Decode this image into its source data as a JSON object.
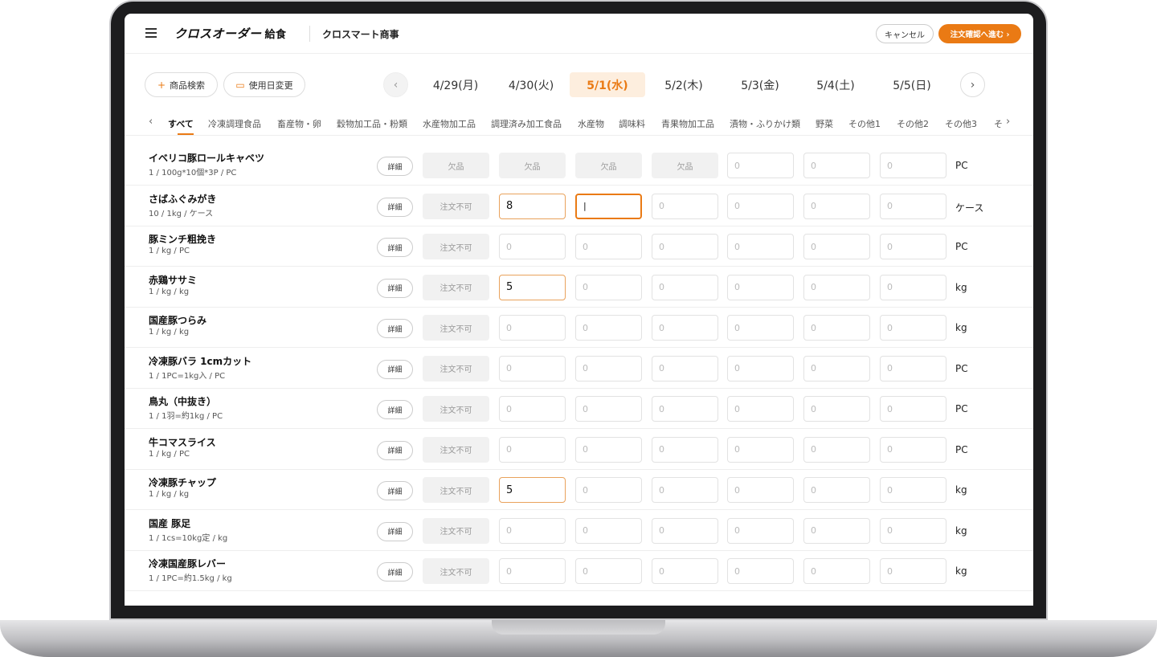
{
  "header": {
    "logo": "クロスオーダー",
    "logo_sub": "給食",
    "company": "クロスマート商事",
    "cancel_label": "キャンセル",
    "next_label": "注文確認へ進む",
    "next_arrow": "›"
  },
  "toolbar": {
    "search_label": "商品検索",
    "search_icon": "+",
    "date_change_label": "使用日変更",
    "date_change_icon": "▭",
    "prev_arrow": "‹",
    "next_arrow": "›",
    "dates": [
      "4/29(月)",
      "4/30(火)",
      "5/1(水)",
      "5/2(木)",
      "5/3(金)",
      "5/4(土)",
      "5/5(日)"
    ],
    "active_date_index": 2
  },
  "categories": {
    "prev_arrow": "‹",
    "next_arrow": "›",
    "items": [
      "すべて",
      "冷凍調理食品",
      "畜産物・卵",
      "穀物加工品・粉類",
      "水産物加工品",
      "調理済み加工食品",
      "水産物",
      "調味料",
      "青果物加工品",
      "漬物・ふりかけ類",
      "野菜",
      "その他1",
      "その他2",
      "その他3",
      "そ"
    ]
  },
  "placeholder": "0",
  "products": [
    {
      "name": "イベリコ豚ロールキャベツ",
      "spec": "1 / 100g*10個*3P / PC",
      "unit": "PC",
      "cells": [
        {
          "t": "status",
          "v": "欠品"
        },
        {
          "t": "status",
          "v": "欠品"
        },
        {
          "t": "status",
          "v": "欠品"
        },
        {
          "t": "status",
          "v": "欠品"
        },
        {
          "t": "empty"
        },
        {
          "t": "empty"
        },
        {
          "t": "empty"
        }
      ]
    },
    {
      "name": "さばふぐみがき",
      "spec": "10 / 1kg / ケース",
      "unit": "ケース",
      "cells": [
        {
          "t": "status",
          "v": "注文不可"
        },
        {
          "t": "filled",
          "v": "8"
        },
        {
          "t": "focused",
          "v": "|"
        },
        {
          "t": "empty"
        },
        {
          "t": "empty"
        },
        {
          "t": "empty"
        },
        {
          "t": "empty"
        }
      ]
    },
    {
      "name": "豚ミンチ粗挽き",
      "spec": "1 / kg / PC",
      "unit": "PC",
      "cells": [
        {
          "t": "status",
          "v": "注文不可"
        },
        {
          "t": "empty"
        },
        {
          "t": "empty"
        },
        {
          "t": "empty"
        },
        {
          "t": "empty"
        },
        {
          "t": "empty"
        },
        {
          "t": "empty"
        }
      ]
    },
    {
      "name": "赤鶏ササミ",
      "spec": "1 / kg / kg",
      "unit": "kg",
      "cells": [
        {
          "t": "status",
          "v": "注文不可"
        },
        {
          "t": "filled",
          "v": "5"
        },
        {
          "t": "empty"
        },
        {
          "t": "empty"
        },
        {
          "t": "empty"
        },
        {
          "t": "empty"
        },
        {
          "t": "empty"
        }
      ]
    },
    {
      "name": "国産豚つらみ",
      "spec": "1 / kg / kg",
      "unit": "kg",
      "cells": [
        {
          "t": "status",
          "v": "注文不可"
        },
        {
          "t": "empty"
        },
        {
          "t": "empty"
        },
        {
          "t": "empty"
        },
        {
          "t": "empty"
        },
        {
          "t": "empty"
        },
        {
          "t": "empty"
        }
      ]
    },
    {
      "name": "冷凍豚バラ 1cmカット",
      "spec": "1 / 1PC=1kg入 / PC",
      "unit": "PC",
      "cells": [
        {
          "t": "status",
          "v": "注文不可"
        },
        {
          "t": "empty"
        },
        {
          "t": "empty"
        },
        {
          "t": "empty"
        },
        {
          "t": "empty"
        },
        {
          "t": "empty"
        },
        {
          "t": "empty"
        }
      ]
    },
    {
      "name": "鳥丸（中抜き）",
      "spec": "1 / 1羽=約1kg / PC",
      "unit": "PC",
      "cells": [
        {
          "t": "status",
          "v": "注文不可"
        },
        {
          "t": "empty"
        },
        {
          "t": "empty"
        },
        {
          "t": "empty"
        },
        {
          "t": "empty"
        },
        {
          "t": "empty"
        },
        {
          "t": "empty"
        }
      ]
    },
    {
      "name": "牛コマスライス",
      "spec": "1 / kg / PC",
      "unit": "PC",
      "cells": [
        {
          "t": "status",
          "v": "注文不可"
        },
        {
          "t": "empty"
        },
        {
          "t": "empty"
        },
        {
          "t": "empty"
        },
        {
          "t": "empty"
        },
        {
          "t": "empty"
        },
        {
          "t": "empty"
        }
      ]
    },
    {
      "name": "冷凍豚チャップ",
      "spec": "1 / kg / kg",
      "unit": "kg",
      "cells": [
        {
          "t": "status",
          "v": "注文不可"
        },
        {
          "t": "filled",
          "v": "5"
        },
        {
          "t": "empty"
        },
        {
          "t": "empty"
        },
        {
          "t": "empty"
        },
        {
          "t": "empty"
        },
        {
          "t": "empty"
        }
      ]
    },
    {
      "name": "国産 豚足",
      "spec": "1 / 1cs=10kg定 / kg",
      "unit": "kg",
      "cells": [
        {
          "t": "status",
          "v": "注文不可"
        },
        {
          "t": "empty"
        },
        {
          "t": "empty"
        },
        {
          "t": "empty"
        },
        {
          "t": "empty"
        },
        {
          "t": "empty"
        },
        {
          "t": "empty"
        }
      ]
    },
    {
      "name": "冷凍国産豚レバー",
      "spec": "1 / 1PC=約1.5kg / kg",
      "unit": "kg",
      "cells": [
        {
          "t": "status",
          "v": "注文不可"
        },
        {
          "t": "empty"
        },
        {
          "t": "empty"
        },
        {
          "t": "empty"
        },
        {
          "t": "empty"
        },
        {
          "t": "empty"
        },
        {
          "t": "empty"
        }
      ]
    }
  ],
  "detail_label": "詳細",
  "colors": {
    "accent": "#ea7a14",
    "accent_light": "#fdeede"
  }
}
